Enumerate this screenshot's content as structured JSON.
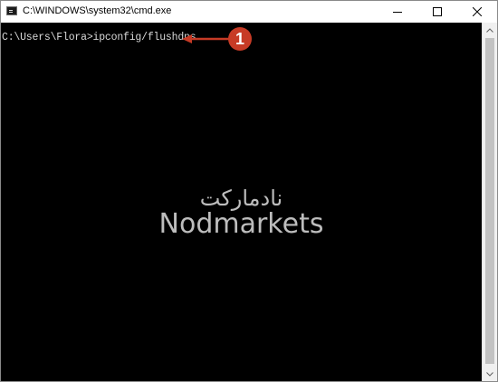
{
  "window": {
    "title": "C:\\WINDOWS\\system32\\cmd.exe",
    "icon": "cmd-icon",
    "controls": [
      "minimize-icon",
      "maximize-icon",
      "close-icon"
    ]
  },
  "console": {
    "prompt_line": "C:\\Users\\Flora>ipconfig/flushdns",
    "background": "#000000",
    "text_color": "#d8d8d8"
  },
  "annotation": {
    "marker_label": "1",
    "color": "#c73b26"
  },
  "watermark": {
    "persian": "نادمارکت",
    "english": "Nodmarkets"
  }
}
